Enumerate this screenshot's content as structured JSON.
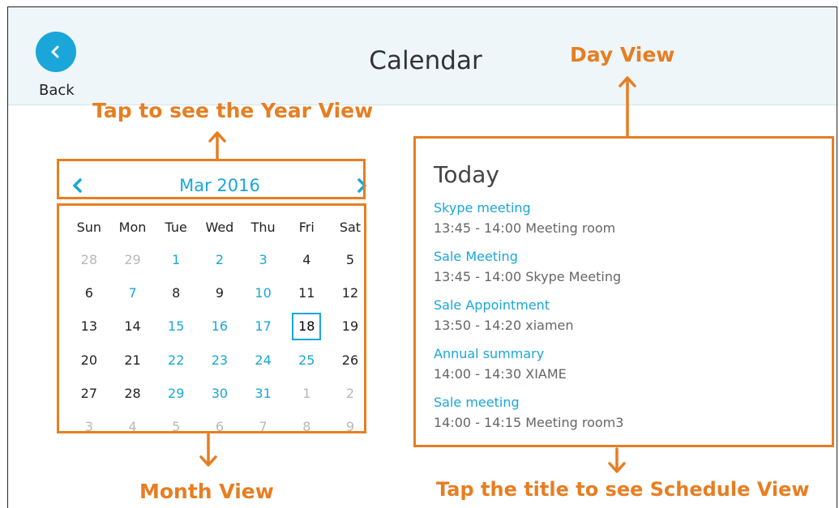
{
  "header": {
    "title": "Calendar",
    "back_label": "Back"
  },
  "annotations": {
    "year_view": "Tap to see the Year View",
    "day_view": "Day View",
    "month_view": "Month View",
    "schedule_view": "Tap the title to see Schedule View"
  },
  "month": {
    "label": "Mar 2016",
    "weekdays": [
      "Sun",
      "Mon",
      "Tue",
      "Wed",
      "Thu",
      "Fri",
      "Sat"
    ],
    "days": [
      {
        "d": "28",
        "s": "muted"
      },
      {
        "d": "29",
        "s": "muted"
      },
      {
        "d": "1",
        "s": "event"
      },
      {
        "d": "2",
        "s": "event"
      },
      {
        "d": "3",
        "s": "event"
      },
      {
        "d": "4",
        "s": "normal"
      },
      {
        "d": "5",
        "s": "normal"
      },
      {
        "d": "6",
        "s": "normal"
      },
      {
        "d": "7",
        "s": "event"
      },
      {
        "d": "8",
        "s": "normal"
      },
      {
        "d": "9",
        "s": "normal"
      },
      {
        "d": "10",
        "s": "event"
      },
      {
        "d": "11",
        "s": "normal"
      },
      {
        "d": "12",
        "s": "normal"
      },
      {
        "d": "13",
        "s": "normal"
      },
      {
        "d": "14",
        "s": "normal"
      },
      {
        "d": "15",
        "s": "event"
      },
      {
        "d": "16",
        "s": "event"
      },
      {
        "d": "17",
        "s": "event"
      },
      {
        "d": "18",
        "s": "today"
      },
      {
        "d": "19",
        "s": "normal"
      },
      {
        "d": "20",
        "s": "normal"
      },
      {
        "d": "21",
        "s": "normal"
      },
      {
        "d": "22",
        "s": "event"
      },
      {
        "d": "23",
        "s": "event"
      },
      {
        "d": "24",
        "s": "event"
      },
      {
        "d": "25",
        "s": "event"
      },
      {
        "d": "26",
        "s": "normal"
      },
      {
        "d": "27",
        "s": "normal"
      },
      {
        "d": "28",
        "s": "normal"
      },
      {
        "d": "29",
        "s": "event"
      },
      {
        "d": "30",
        "s": "event"
      },
      {
        "d": "31",
        "s": "event"
      },
      {
        "d": "1",
        "s": "muted"
      },
      {
        "d": "2",
        "s": "muted"
      },
      {
        "d": "3",
        "s": "muted"
      },
      {
        "d": "4",
        "s": "muted"
      },
      {
        "d": "5",
        "s": "muted"
      },
      {
        "d": "6",
        "s": "muted"
      },
      {
        "d": "7",
        "s": "muted"
      },
      {
        "d": "8",
        "s": "muted"
      },
      {
        "d": "9",
        "s": "muted"
      }
    ]
  },
  "day_view": {
    "title": "Today",
    "events": [
      {
        "title": "Skype meeting",
        "detail": "13:45 - 14:00 Meeting room"
      },
      {
        "title": "Sale Meeting",
        "detail": "13:45 - 14:00 Skype Meeting"
      },
      {
        "title": "Sale Appointment",
        "detail": "13:50 - 14:20 xiamen"
      },
      {
        "title": "Annual summary",
        "detail": "14:00 - 14:30 XIAME"
      },
      {
        "title": "Sale meeting",
        "detail": "14:00 - 14:15 Meeting room3"
      }
    ]
  },
  "icons": {
    "back": "chevron-left-icon",
    "prev": "chevron-left-icon",
    "next": "chevron-right-icon"
  },
  "colors": {
    "accent": "#1aa6d8",
    "annotation": "#e67e22",
    "header_bg": "#eef6f9"
  }
}
